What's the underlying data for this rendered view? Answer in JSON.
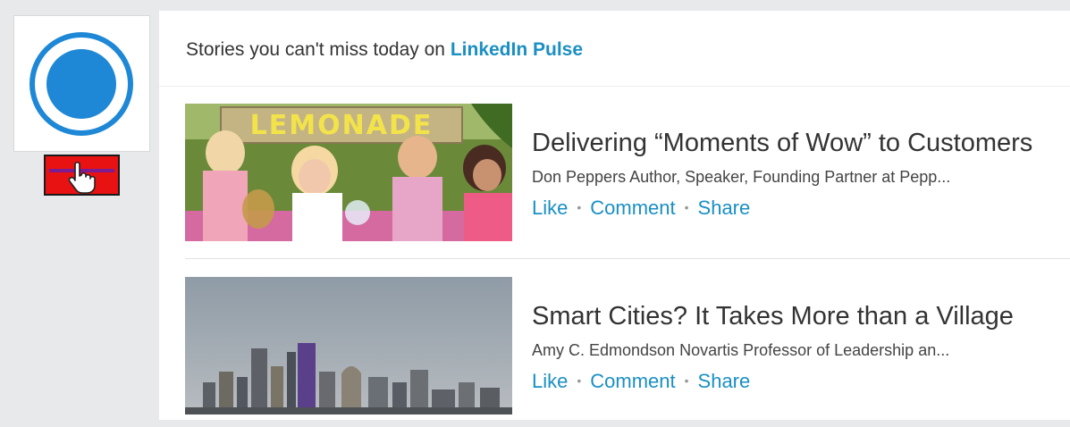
{
  "header": {
    "prefix_text": "Stories you can't miss today on ",
    "link_text": "LinkedIn Pulse"
  },
  "icons": {
    "app_logo": "concentric-circle-logo-icon",
    "cursor": "hand-pointer-cursor-icon"
  },
  "colors": {
    "accent_link": "#1a8fc4",
    "logo_blue": "#1e88d6",
    "cursor_badge_bg": "#e81212",
    "rail_bg": "#e8e9eb"
  },
  "stories": [
    {
      "title": "Delivering “Moments of Wow” to Customers",
      "author": "Don Peppers Author, Speaker, Founding Partner at Pepp...",
      "actions": {
        "like": "Like",
        "comment": "Comment",
        "share": "Share"
      },
      "image_text": "LEMONADE"
    },
    {
      "title": "Smart Cities? It Takes More than a Village",
      "author": "Amy C. Edmondson Novartis Professor of Leadership an...",
      "actions": {
        "like": "Like",
        "comment": "Comment",
        "share": "Share"
      }
    }
  ],
  "separator": "•"
}
